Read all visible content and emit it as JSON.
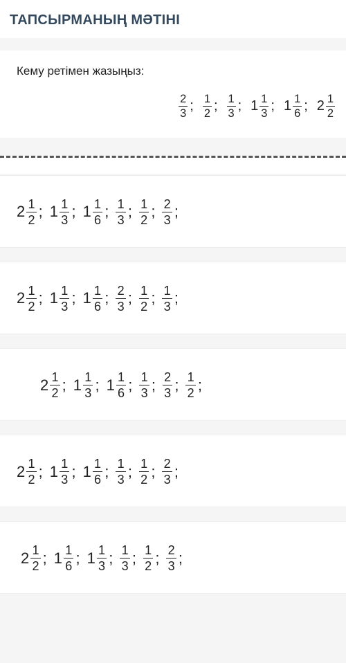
{
  "header": {
    "title": "ТАПСЫРМАНЫҢ МӘТІНІ"
  },
  "question": {
    "prompt": "Кему ретімен жазыңыз:",
    "given": [
      {
        "whole": "",
        "num": "2",
        "den": "3"
      },
      {
        "whole": "",
        "num": "1",
        "den": "2"
      },
      {
        "whole": "",
        "num": "1",
        "den": "3"
      },
      {
        "whole": "1",
        "num": "1",
        "den": "3"
      },
      {
        "whole": "1",
        "num": "1",
        "den": "6"
      },
      {
        "whole": "2",
        "num": "1",
        "den": "2"
      }
    ]
  },
  "options": [
    {
      "indent": "none",
      "items": [
        {
          "whole": "2",
          "num": "1",
          "den": "2"
        },
        {
          "whole": "1",
          "num": "1",
          "den": "3"
        },
        {
          "whole": "1",
          "num": "1",
          "den": "6"
        },
        {
          "whole": "",
          "num": "1",
          "den": "3"
        },
        {
          "whole": "",
          "num": "1",
          "den": "2"
        },
        {
          "whole": "",
          "num": "2",
          "den": "3"
        }
      ]
    },
    {
      "indent": "none",
      "items": [
        {
          "whole": "2",
          "num": "1",
          "den": "2"
        },
        {
          "whole": "1",
          "num": "1",
          "den": "3"
        },
        {
          "whole": "1",
          "num": "1",
          "den": "6"
        },
        {
          "whole": "",
          "num": "2",
          "den": "3"
        },
        {
          "whole": "",
          "num": "1",
          "den": "2"
        },
        {
          "whole": "",
          "num": "1",
          "den": "3"
        }
      ]
    },
    {
      "indent": "md",
      "items": [
        {
          "whole": "2",
          "num": "1",
          "den": "2"
        },
        {
          "whole": "1",
          "num": "1",
          "den": "3"
        },
        {
          "whole": "1",
          "num": "1",
          "den": "6"
        },
        {
          "whole": "",
          "num": "1",
          "den": "3"
        },
        {
          "whole": "",
          "num": "2",
          "den": "3"
        },
        {
          "whole": "",
          "num": "1",
          "den": "2"
        }
      ]
    },
    {
      "indent": "none",
      "items": [
        {
          "whole": "2",
          "num": "1",
          "den": "2"
        },
        {
          "whole": "1",
          "num": "1",
          "den": "3"
        },
        {
          "whole": "1",
          "num": "1",
          "den": "6"
        },
        {
          "whole": "",
          "num": "1",
          "den": "3"
        },
        {
          "whole": "",
          "num": "1",
          "den": "2"
        },
        {
          "whole": "",
          "num": "2",
          "den": "3"
        }
      ]
    },
    {
      "indent": "sm",
      "items": [
        {
          "whole": "2",
          "num": "1",
          "den": "2"
        },
        {
          "whole": "1",
          "num": "1",
          "den": "6"
        },
        {
          "whole": "1",
          "num": "1",
          "den": "3"
        },
        {
          "whole": "",
          "num": "1",
          "den": "3"
        },
        {
          "whole": "",
          "num": "1",
          "den": "2"
        },
        {
          "whole": "",
          "num": "2",
          "den": "3"
        }
      ]
    }
  ],
  "separator": ";"
}
